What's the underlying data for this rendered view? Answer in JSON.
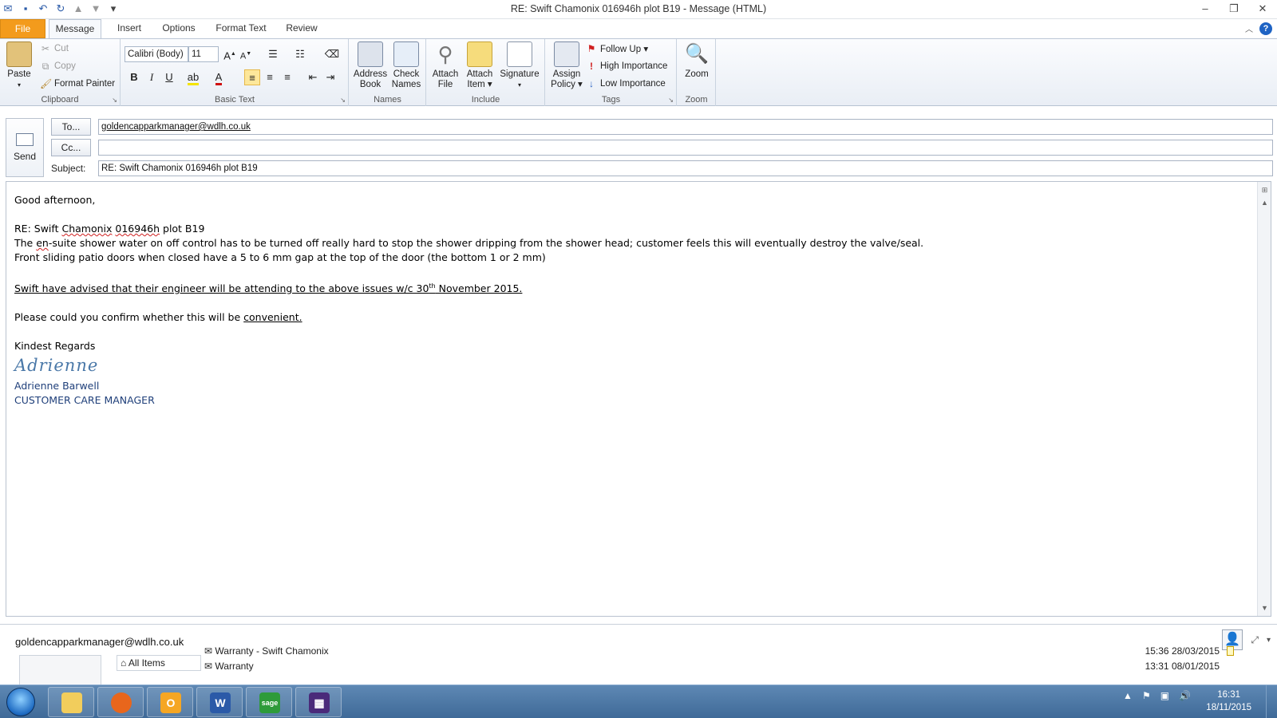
{
  "window": {
    "title": "RE: Swift Chamonix  016946h plot B19  -  Message (HTML)"
  },
  "tabs": [
    "File",
    "Message",
    "Insert",
    "Options",
    "Format Text",
    "Review"
  ],
  "ribbon": {
    "clipboard": {
      "paste": "Paste",
      "cut": "Cut",
      "copy": "Copy",
      "format_painter": "Format Painter",
      "label": "Clipboard"
    },
    "basic_text": {
      "font": "Calibri (Body)",
      "size": "11",
      "label": "Basic Text"
    },
    "names": {
      "address_book_1": "Address",
      "address_book_2": "Book",
      "check_names_1": "Check",
      "check_names_2": "Names",
      "label": "Names"
    },
    "include": {
      "attach_file_1": "Attach",
      "attach_file_2": "File",
      "attach_item_1": "Attach",
      "attach_item_2": "Item ▾",
      "signature": "Signature",
      "label": "Include"
    },
    "tags": {
      "assign_policy_1": "Assign",
      "assign_policy_2": "Policy ▾",
      "follow_up": "Follow Up ▾",
      "high_importance": "High Importance",
      "low_importance": "Low Importance",
      "label": "Tags"
    },
    "zoom": {
      "zoom": "Zoom",
      "label": "Zoom"
    }
  },
  "compose": {
    "send": "Send",
    "to_button": "To...",
    "cc_button": "Cc...",
    "subject_label": "Subject:",
    "to_value": "goldencapparkmanager@wdlh.co.uk",
    "cc_value": "",
    "subject_value": "RE: Swift Chamonix  016946h plot B19"
  },
  "body": {
    "greeting": "Good afternoon,",
    "re_prefix": "RE: Swift ",
    "re_chamonix": "Chamonix",
    "re_code": "016946h",
    "re_suffix": " plot B19",
    "line1_a": "The ",
    "line1_en": "en",
    "line1_b": "-suite shower water on off control has to be turned off really hard to stop the shower dripping from the shower head; customer feels this will eventually destroy the valve/seal.",
    "line2": "Front sliding patio doors when closed have a 5 to 6 mm gap at the top of the door (the bottom 1 or 2 mm)",
    "line3_a": "Swift have advised that their engineer will be attending to the above issues w/c 30",
    "line3_sup": "th",
    "line3_b": " November 2015.",
    "line4_a": "Please could you confirm whether this will be ",
    "line4_b": "convenient.",
    "closing": "Kindest Regards",
    "signature_script": "Adrienne",
    "sig_name": "Adrienne Barwell",
    "sig_title": "CUSTOMER CARE MANAGER"
  },
  "people_pane": {
    "contact": "goldencapparkmanager@wdlh.co.uk",
    "filter": "All Items",
    "items": [
      {
        "subject": "Warranty - Swift Chamonix",
        "time": "15:36  28/03/2015"
      },
      {
        "subject": "Warranty",
        "time": "13:31  08/01/2015"
      }
    ]
  },
  "taskbar": {
    "time": "16:31",
    "date": "18/11/2015",
    "apps": [
      "explorer-icon",
      "firefox-icon",
      "outlook-icon",
      "word-icon",
      "sage-icon",
      "calculator-icon"
    ]
  },
  "colors": {
    "file_tab": "#f39b1c",
    "signature": "#4a78a8",
    "sig_text": "#1f3f7a"
  }
}
